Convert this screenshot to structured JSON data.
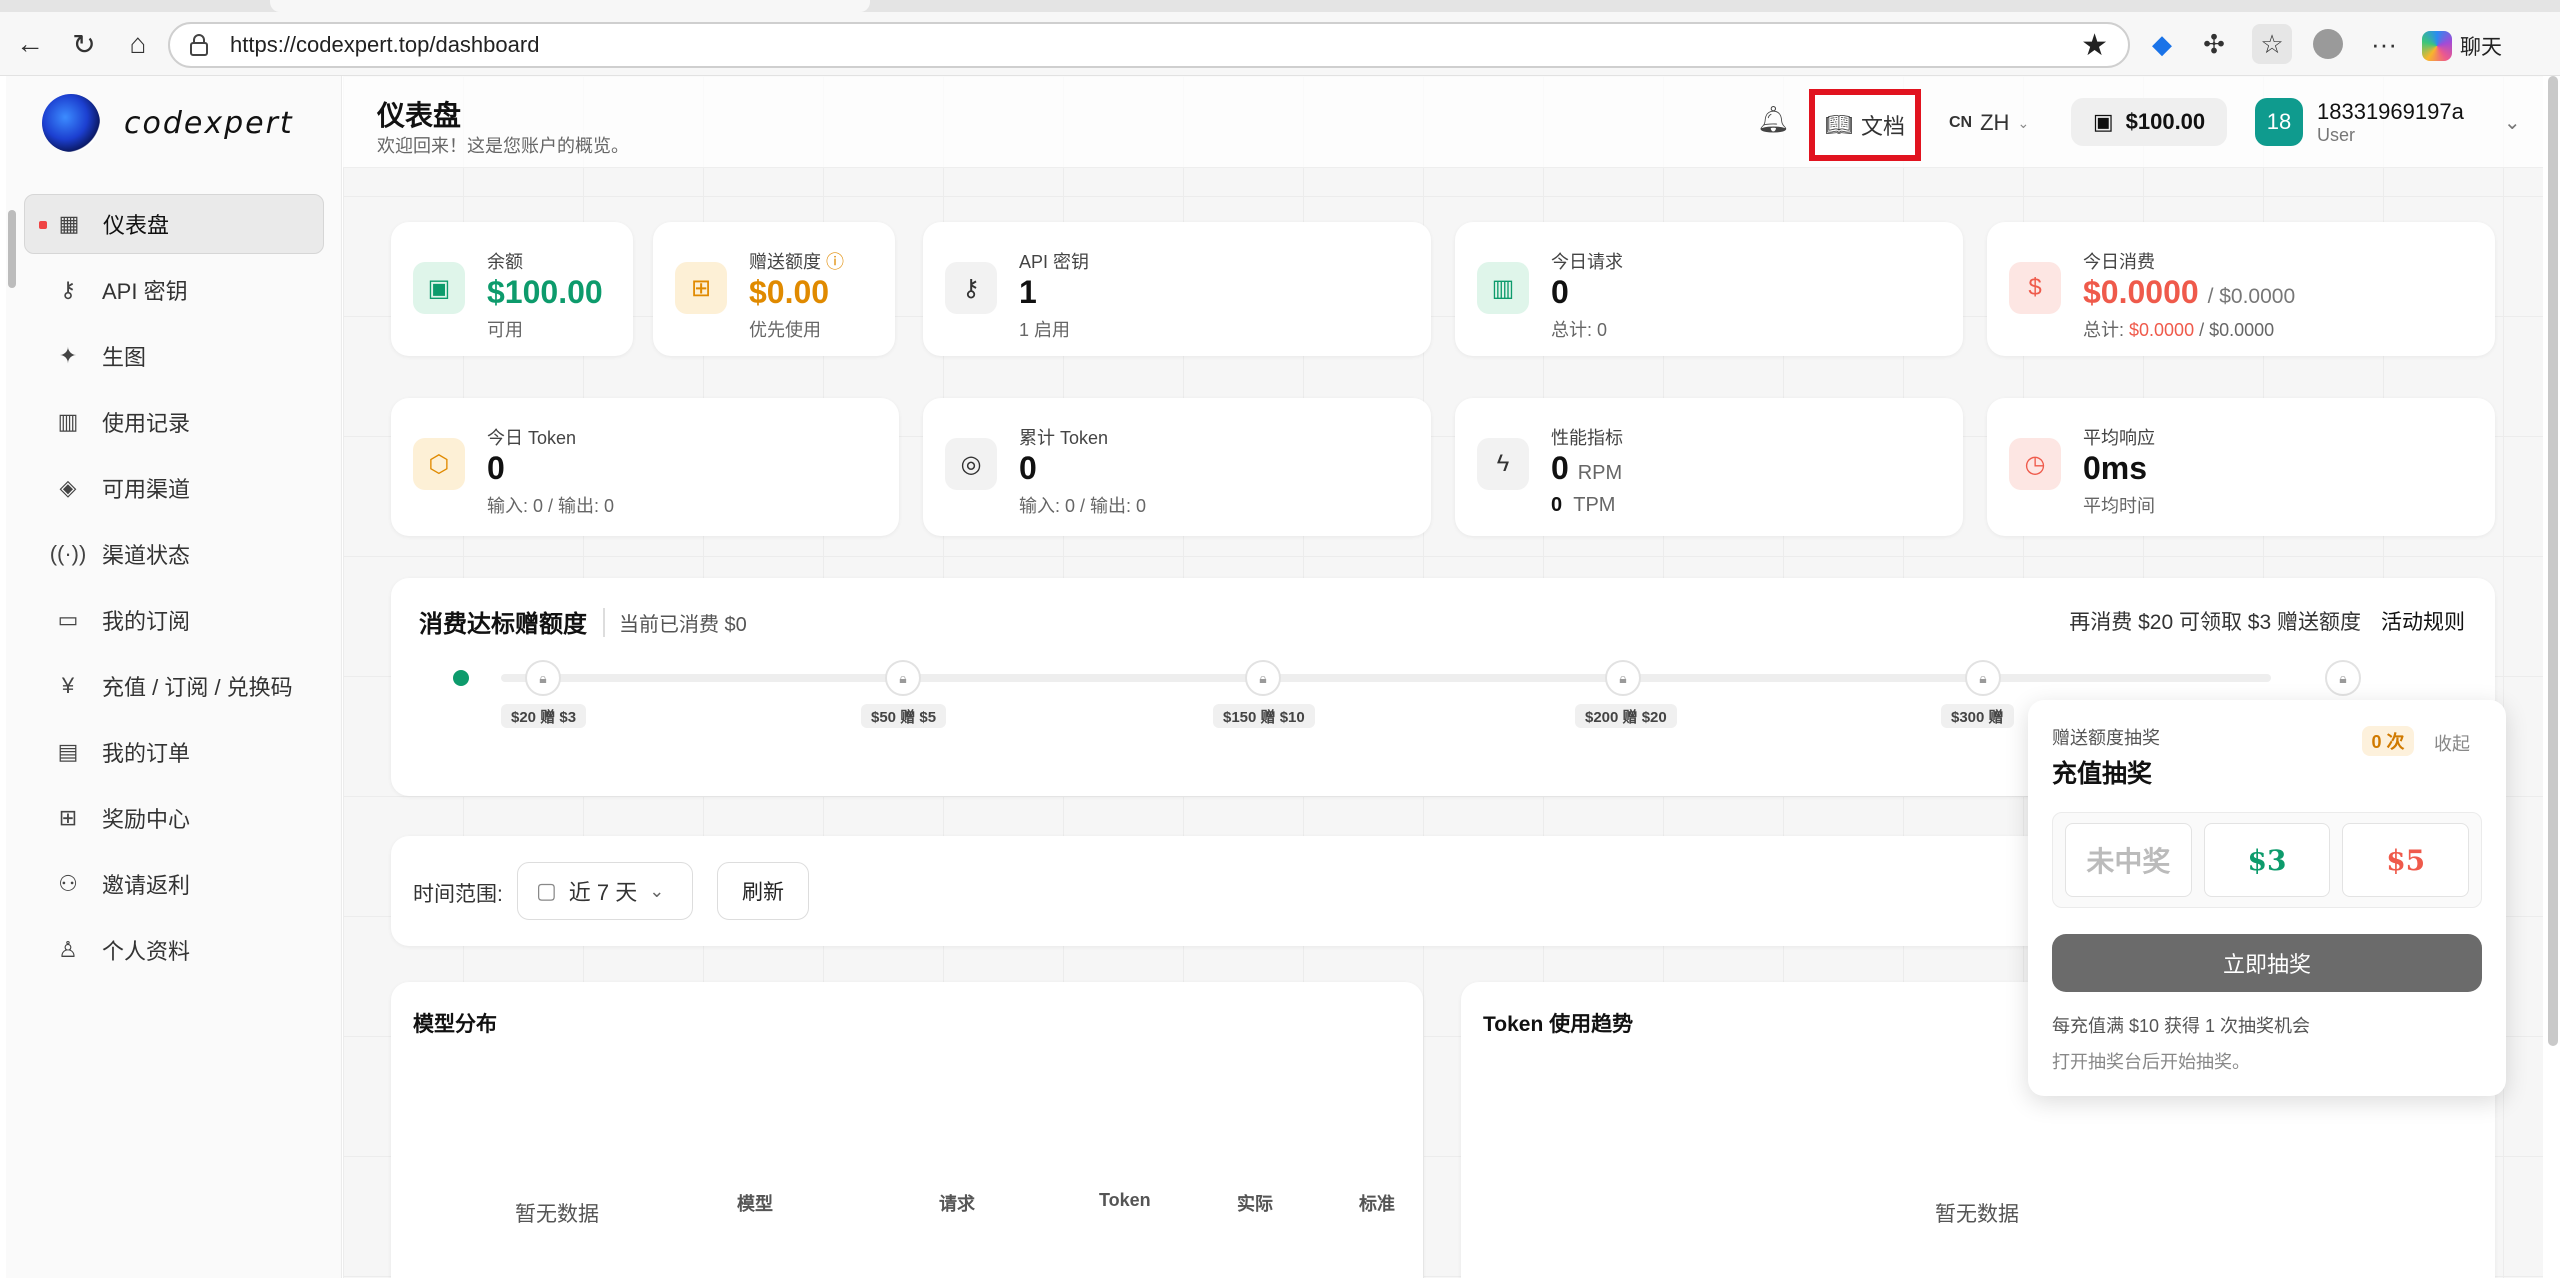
{
  "browser": {
    "url": "https://codexpert.top/dashboard",
    "chat_label": "聊天"
  },
  "sidebar": {
    "logo_text": "codexpert",
    "items": [
      {
        "label": "仪表盘",
        "icon": "grid-icon"
      },
      {
        "label": "API 密钥",
        "icon": "key-icon"
      },
      {
        "label": "生图",
        "icon": "sparkle-icon"
      },
      {
        "label": "使用记录",
        "icon": "bar-chart-icon"
      },
      {
        "label": "可用渠道",
        "icon": "layers-icon"
      },
      {
        "label": "渠道状态",
        "icon": "signal-icon"
      },
      {
        "label": "我的订阅",
        "icon": "card-icon"
      },
      {
        "label": "充值 / 订阅 / 兑换码",
        "icon": "yen-icon"
      },
      {
        "label": "我的订单",
        "icon": "file-icon"
      },
      {
        "label": "奖励中心",
        "icon": "gift-icon"
      },
      {
        "label": "邀请返利",
        "icon": "users-icon"
      },
      {
        "label": "个人资料",
        "icon": "user-icon"
      }
    ]
  },
  "header": {
    "title": "仪表盘",
    "subtitle": "欢迎回来！这是您账户的概览。",
    "docs_label": "文档",
    "lang_flag": "CN",
    "lang_label": "ZH",
    "balance": "$100.00",
    "user_avatar": "18",
    "user_name": "18331969197a",
    "user_role": "User"
  },
  "stats": {
    "balance": {
      "label": "余额",
      "value": "$100.00",
      "sub": "可用"
    },
    "bonus": {
      "label": "赠送额度",
      "value": "$0.00",
      "sub": "优先使用"
    },
    "apikey": {
      "label": "API 密钥",
      "value": "1",
      "sub": "1 启用"
    },
    "requests": {
      "label": "今日请求",
      "value": "0",
      "sub": "总计: 0"
    },
    "spend": {
      "label": "今日消费",
      "value": "$0.0000",
      "value2": "/ $0.0000",
      "sub_prefix": "总计: ",
      "sub_red": "$0.0000",
      "sub_rest": " / $0.0000"
    },
    "token_today": {
      "label": "今日 Token",
      "value": "0",
      "sub": "输入: 0 / 输出: 0"
    },
    "token_total": {
      "label": "累计 Token",
      "value": "0",
      "sub": "输入: 0 / 输出: 0"
    },
    "perf": {
      "label": "性能指标",
      "rpm": "0",
      "rpm_unit": "RPM",
      "tpm": "0",
      "tpm_unit": "TPM"
    },
    "latency": {
      "label": "平均响应",
      "value": "0ms",
      "sub": "平均时间"
    }
  },
  "progress": {
    "title": "消费达标赠额度",
    "current": "当前已消费 $0",
    "hint": "再消费 $20 可领取 $3 赠送额度",
    "rules": "活动规则",
    "milestones": [
      "$20 赠 $3",
      "$50 赠 $5",
      "$150 赠 $10",
      "$200 赠 $20",
      "$300 赠"
    ]
  },
  "filter": {
    "label": "时间范围:",
    "range": "近 7 天",
    "refresh": "刷新"
  },
  "panels": {
    "model_title": "模型分布",
    "model_empty": "暂无数据",
    "columns": [
      "模型",
      "请求",
      "Token",
      "实际",
      "标准"
    ],
    "token_title": "Token 使用趋势",
    "token_empty": "暂无数据"
  },
  "lottery": {
    "kicker": "赠送额度抽奖",
    "title": "充值抽奖",
    "count": "0 次",
    "collapse": "收起",
    "prizes": [
      "未中奖",
      "$3",
      "$5"
    ],
    "draw": "立即抽奖",
    "note1": "每充值满 $10 获得 1 次抽奖机会",
    "note2": "打开抽奖台后开始抽奖。"
  },
  "colors": {
    "accent_green": "#0d9b6c",
    "accent_orange": "#e08a00",
    "accent_red": "#ef5a4b",
    "highlight": "#e1131f"
  }
}
